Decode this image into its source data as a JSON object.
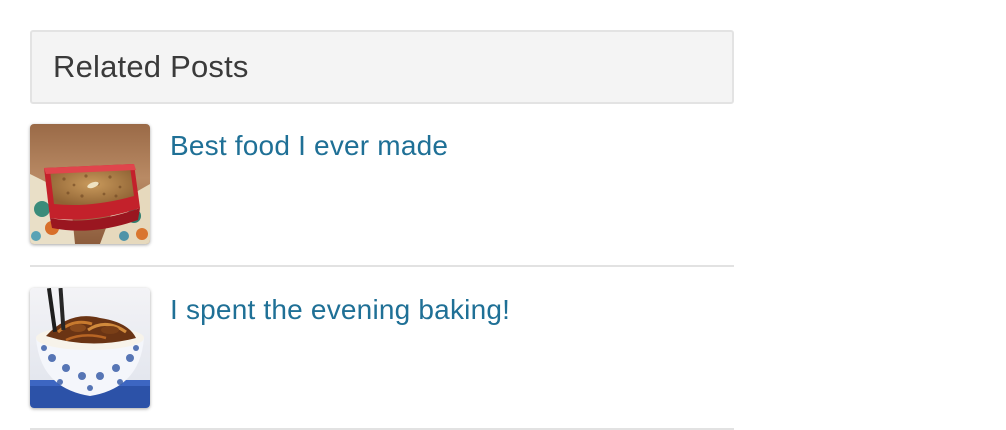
{
  "related_posts": {
    "title": "Related Posts",
    "items": [
      {
        "title": "Best food I ever made",
        "thumbnail": "baked-crumble-dish-image"
      },
      {
        "title": "I spent the evening baking!",
        "thumbnail": "beef-rice-bowl-image"
      }
    ]
  },
  "colors": {
    "link": "#1f7096",
    "header_bg": "#f4f4f4",
    "divider": "#e2e2e2"
  }
}
